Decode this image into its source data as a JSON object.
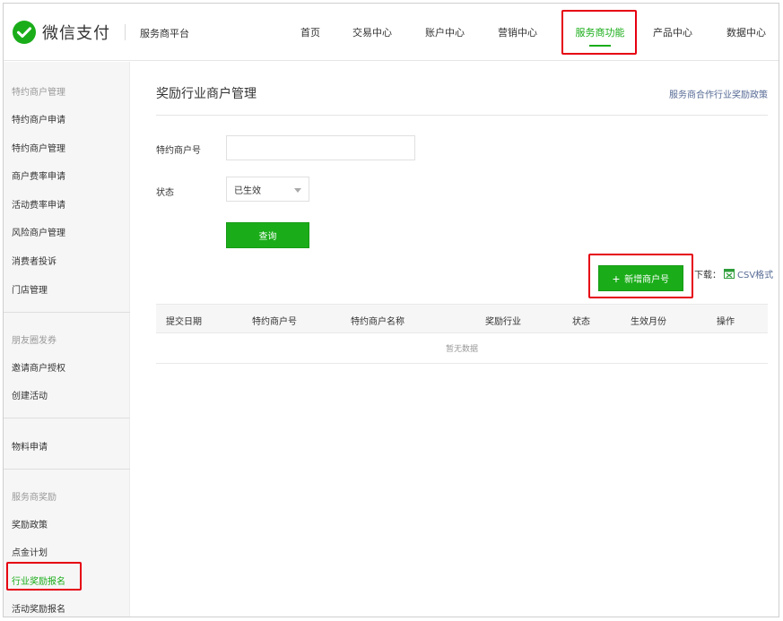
{
  "header": {
    "logo_text": "微信支付",
    "platform": "服务商平台",
    "nav": [
      {
        "label": "首页",
        "active": false
      },
      {
        "label": "交易中心",
        "active": false
      },
      {
        "label": "账户中心",
        "active": false
      },
      {
        "label": "营销中心",
        "active": false
      },
      {
        "label": "服务商功能",
        "active": true
      },
      {
        "label": "产品中心",
        "active": false
      },
      {
        "label": "数据中心",
        "active": false
      }
    ]
  },
  "sidebar": {
    "groups": [
      {
        "title": "特约商户管理",
        "items": [
          "特约商户申请",
          "特约商户管理",
          "商户费率申请",
          "活动费率申请",
          "风险商户管理",
          "消费者投诉",
          "门店管理"
        ]
      },
      {
        "title": "朋友圈发券",
        "items": [
          "邀请商户授权",
          "创建活动"
        ]
      },
      {
        "title": "",
        "items": [
          "物料申请"
        ]
      },
      {
        "title": "服务商奖励",
        "items": [
          "奖励政策",
          "点金计划",
          "行业奖励报名",
          "活动奖励报名"
        ]
      }
    ],
    "active_item": "行业奖励报名"
  },
  "main": {
    "title": "奖励行业商户管理",
    "policy_link": "服务商合作行业奖励政策",
    "merchant_id_label": "特约商户号",
    "merchant_id_value": "",
    "status_label": "状态",
    "status_value": "已生效",
    "query_button": "查询",
    "add_button": "新增商户号",
    "download_label": "下载：",
    "csv_link": "CSV格式",
    "table": {
      "columns": [
        "提交日期",
        "特约商户号",
        "特约商户名称",
        "奖励行业",
        "状态",
        "生效月份",
        "操作"
      ],
      "empty_text": "暂无数据"
    }
  },
  "colors": {
    "brand_green": "#1aad19",
    "link_blue": "#576b95",
    "highlight_red": "#e60012"
  },
  "icons": {
    "logo": "wechat-pay-logo",
    "select_caret": "chevron-down-icon",
    "add": "plus-icon",
    "csv": "csv-file-icon"
  }
}
